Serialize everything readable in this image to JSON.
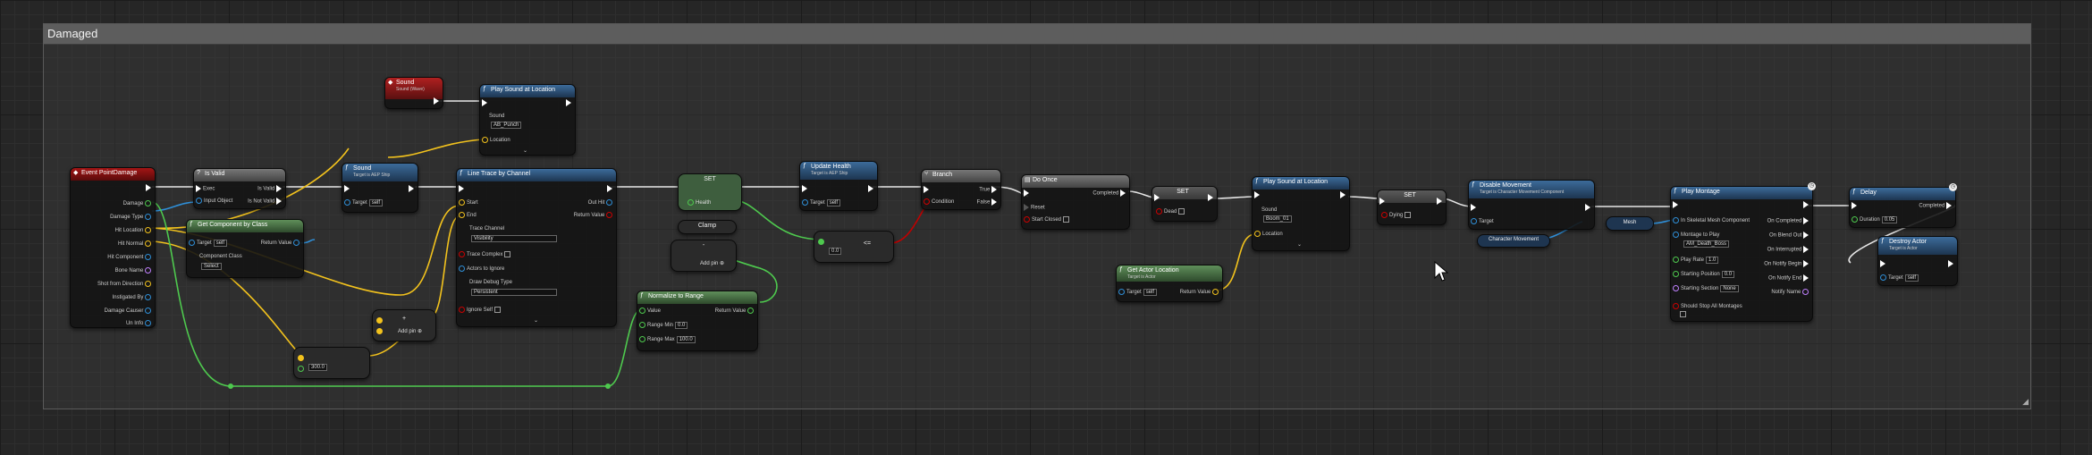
{
  "comment": {
    "title": "Damaged"
  },
  "nodes": {
    "event": {
      "title": "Event PointDamage",
      "pins": [
        "Damage",
        "Damage Type",
        "Hit Location",
        "Hit Normal",
        "Hit Component",
        "Bone Name",
        "Shot from Direction",
        "Instigated By",
        "Damage Causer",
        "Un Info"
      ]
    },
    "isvalid": {
      "title": "Is Valid",
      "pins": [
        "Exec",
        "Is Valid",
        "Input Object",
        "Is Not Valid"
      ]
    },
    "getcomp": {
      "title": "Get Component by Class",
      "target_label": "Target",
      "target_val": "self",
      "return_label": "Return Value",
      "class_label": "Component Class",
      "class_val": "Select"
    },
    "sound_var": {
      "title": "Sound",
      "sub": "Sound (Wave)"
    },
    "sound2": {
      "title": "Sound",
      "sub": "Target is AEP Ship",
      "target_label": "Target",
      "target_val": "self"
    },
    "playsound1": {
      "title": "Play Sound at Location",
      "sound_label": "Sound",
      "sound_val": "AB_Punch",
      "loc_label": "Location"
    },
    "trace": {
      "title": "Line Trace by Channel",
      "start": "Start",
      "end": "End",
      "outhit": "Out Hit",
      "retval": "Return Value",
      "channel_label": "Trace Channel",
      "channel_val": "Visibility",
      "complex": "Trace Complex",
      "ignore": "Actors to Ignore",
      "debug_label": "Draw Debug Type",
      "debug_val": "Persistent",
      "ignoreself": "Ignore Self"
    },
    "set1": {
      "title": "SET",
      "pin": "Health"
    },
    "clamp": {
      "title": "Clamp"
    },
    "minus": {
      "title": "-",
      "addpin": "Add pin"
    },
    "normalize": {
      "title": "Normalize to Range",
      "value": "Value",
      "ret": "Return Value",
      "rmin_label": "Range Min",
      "rmin": "0.0",
      "rmax_label": "Range Max",
      "rmax": "100.0"
    },
    "addpin": {
      "title": "+",
      "addpin": "Add pin"
    },
    "const": {
      "val": "300.0"
    },
    "update": {
      "title": "Update Health",
      "sub": "Target is AEP Ship",
      "target_label": "Target",
      "target_val": "self"
    },
    "lesseq": {
      "title": "<=",
      "val": "0.0"
    },
    "branch": {
      "title": "Branch",
      "cond": "Condition",
      "t": "True",
      "f": "False"
    },
    "doonce": {
      "title": "Do Once",
      "completed": "Completed",
      "reset": "Reset",
      "startclosed": "Start Closed"
    },
    "set2": {
      "title": "SET",
      "pin": "Dead"
    },
    "playsound2": {
      "title": "Play Sound at Location",
      "sound_label": "Sound",
      "sound_val": "Boom_01",
      "loc_label": "Location"
    },
    "getloc": {
      "title": "Get Actor Location",
      "sub": "Target is Actor",
      "target_label": "Target",
      "target_val": "self",
      "ret": "Return Value"
    },
    "set3": {
      "title": "SET",
      "pin": "Dying"
    },
    "disable": {
      "title": "Disable Movement",
      "sub": "Target is Character Movement Component",
      "target": "Target"
    },
    "charmove": {
      "title": "Character Movement"
    },
    "mesh": {
      "title": "Mesh"
    },
    "montage": {
      "title": "Play Montage",
      "pins": [
        "In Skeletal Mesh Component",
        "Montage to Play",
        "Play Rate",
        "Starting Position",
        "Starting Section",
        "Should Stop All Montages"
      ],
      "outs": [
        "On Completed",
        "On Blend Out",
        "On Interrupted",
        "On Notify Begin",
        "On Notify End",
        "Notify Name"
      ],
      "montage_val": "AM_Death_Boss",
      "rate": "1.0",
      "pos": "0.0",
      "section": "None"
    },
    "delay": {
      "title": "Delay",
      "completed": "Completed",
      "duration_label": "Duration",
      "duration": "0.05"
    },
    "destroy": {
      "title": "Destroy Actor",
      "sub": "Target is Actor",
      "target_label": "Target",
      "target_val": "self"
    }
  },
  "colors": {
    "exec": "#ffffff",
    "float": "#9cf04a",
    "object": "#2f8fd8",
    "vector": "#f2c21d",
    "bool": "#8a0000"
  }
}
